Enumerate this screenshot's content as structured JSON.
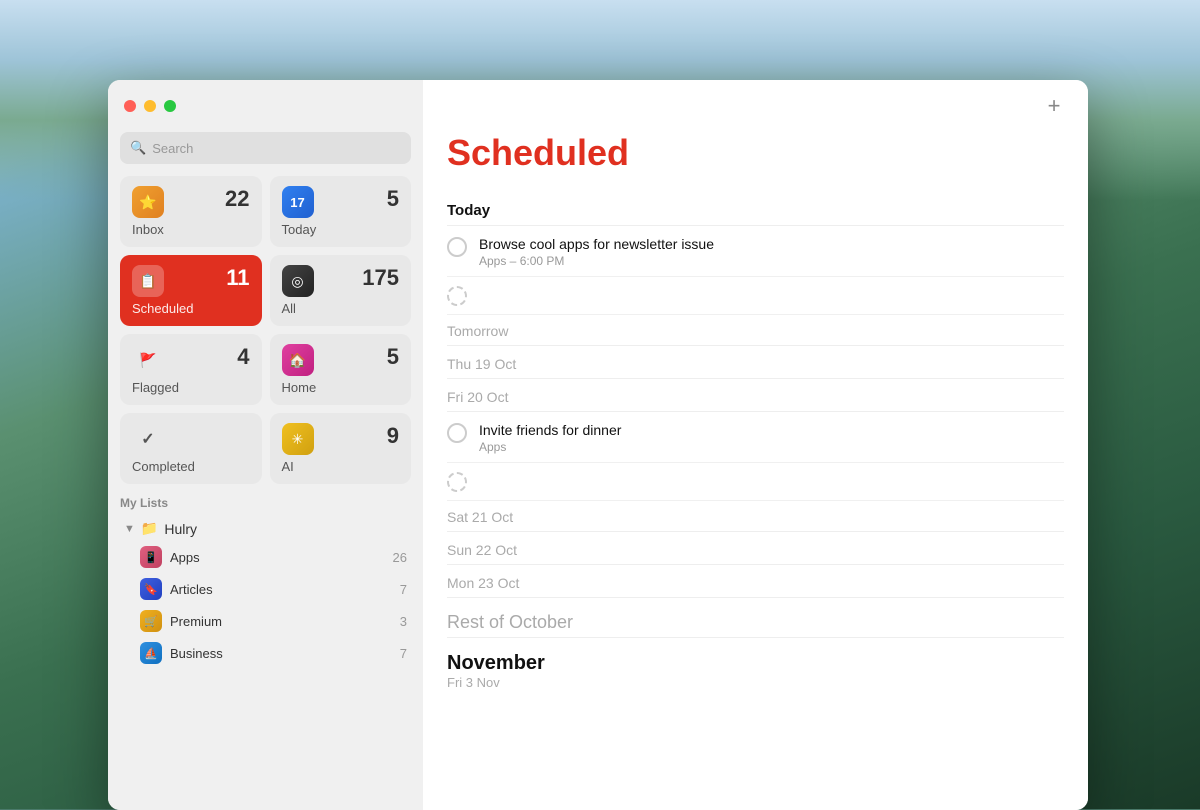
{
  "window": {
    "title": "Scheduled"
  },
  "titlebar": {
    "red_label": "close",
    "yellow_label": "minimize",
    "green_label": "fullscreen"
  },
  "search": {
    "placeholder": "Search"
  },
  "smart_lists": [
    {
      "id": "inbox",
      "icon_char": "⭐",
      "icon_class": "icon-inbox",
      "count": "22",
      "label": "Inbox",
      "active": false
    },
    {
      "id": "today",
      "icon_char": "📅",
      "icon_class": "icon-today",
      "count": "5",
      "label": "Today",
      "active": false
    },
    {
      "id": "scheduled",
      "icon_char": "📋",
      "icon_class": "icon-scheduled",
      "count": "11",
      "label": "Scheduled",
      "active": true
    },
    {
      "id": "all",
      "icon_char": "◎",
      "icon_class": "icon-all",
      "count": "175",
      "label": "All",
      "active": false
    },
    {
      "id": "flagged",
      "icon_char": "🚩",
      "icon_class": "icon-flagged",
      "count": "4",
      "label": "Flagged",
      "active": false
    },
    {
      "id": "home",
      "icon_char": "🏠",
      "icon_class": "icon-home",
      "count": "5",
      "label": "Home",
      "active": false
    },
    {
      "id": "completed",
      "icon_char": "✓",
      "icon_class": "icon-completed",
      "count": "",
      "label": "Completed",
      "active": false
    },
    {
      "id": "ai",
      "icon_char": "✳",
      "icon_class": "icon-ai",
      "count": "9",
      "label": "AI",
      "active": false
    }
  ],
  "my_lists": {
    "header": "My Lists",
    "group": {
      "name": "Hulry",
      "icon": "📁",
      "items": [
        {
          "id": "apps",
          "name": "Apps",
          "icon_char": "📱",
          "icon_class": "list-apps",
          "count": "26"
        },
        {
          "id": "articles",
          "name": "Articles",
          "icon_char": "🔖",
          "icon_class": "list-articles",
          "count": "7"
        },
        {
          "id": "premium",
          "name": "Premium",
          "icon_char": "🛒",
          "icon_class": "list-premium",
          "count": "3"
        },
        {
          "id": "business",
          "name": "Business",
          "icon_char": "⛵",
          "icon_class": "list-business",
          "count": "7"
        }
      ]
    }
  },
  "main": {
    "title": "Scheduled",
    "add_button": "+",
    "sections": [
      {
        "id": "today",
        "header": "Today",
        "header_style": "bold",
        "tasks": [
          {
            "id": "task1",
            "title": "Browse cool apps for newsletter issue",
            "meta": "Apps – 6:00 PM",
            "checkbox_type": "solid"
          },
          {
            "id": "task1b",
            "title": "",
            "meta": "",
            "checkbox_type": "dashed"
          }
        ]
      },
      {
        "id": "tomorrow",
        "header": "Tomorrow",
        "header_style": "light",
        "tasks": []
      },
      {
        "id": "thu19",
        "header": "Thu 19 Oct",
        "header_style": "light",
        "tasks": []
      },
      {
        "id": "fri20",
        "header": "Fri 20 Oct",
        "header_style": "light",
        "tasks": [
          {
            "id": "task2",
            "title": "Invite friends for dinner",
            "meta": "Apps",
            "checkbox_type": "solid"
          },
          {
            "id": "task2b",
            "title": "",
            "meta": "",
            "checkbox_type": "dashed"
          }
        ]
      },
      {
        "id": "sat21",
        "header": "Sat 21 Oct",
        "header_style": "light",
        "tasks": []
      },
      {
        "id": "sun22",
        "header": "Sun 22 Oct",
        "header_style": "light",
        "tasks": []
      },
      {
        "id": "mon23",
        "header": "Mon 23 Oct",
        "header_style": "light",
        "tasks": []
      },
      {
        "id": "rest-october",
        "header": "Rest of October",
        "header_style": "light-big",
        "tasks": []
      },
      {
        "id": "november",
        "header": "November",
        "sub_header": "Fri 3 Nov",
        "header_style": "bold-big",
        "tasks": []
      }
    ]
  }
}
